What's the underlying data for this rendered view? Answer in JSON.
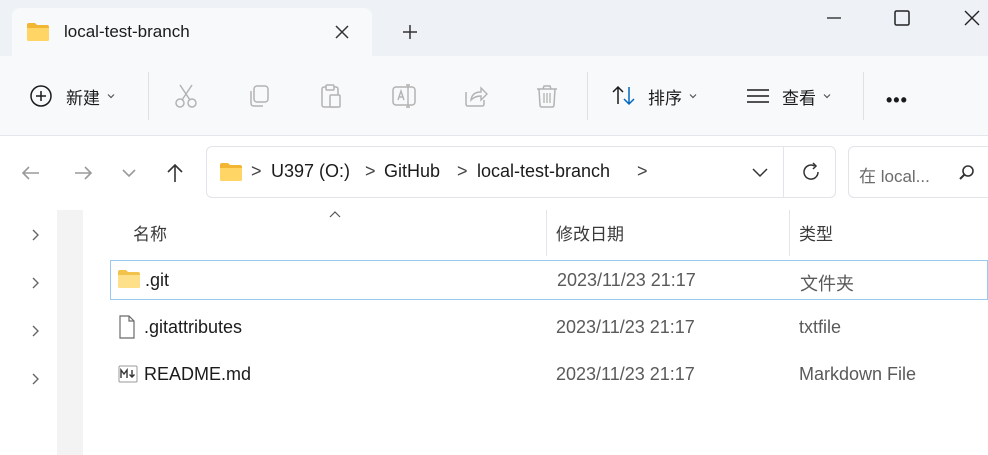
{
  "window": {
    "tab_title": "local-test-branch",
    "icons": [
      "folder-icon",
      "close-icon",
      "plus-icon",
      "minimize-icon",
      "maximize-icon",
      "window-close-icon"
    ]
  },
  "toolbar": {
    "new_label": "新建",
    "sort_label": "排序",
    "view_label": "查看",
    "more_label": "•••"
  },
  "address": {
    "segments": [
      "U397 (O:)",
      "GitHub",
      "local-test-branch"
    ],
    "separator": ">"
  },
  "search": {
    "placeholder": "在 local..."
  },
  "columns": {
    "name": "名称",
    "modified": "修改日期",
    "type": "类型"
  },
  "files": [
    {
      "name": ".git",
      "modified": "2023/11/23 21:17",
      "type": "文件夹",
      "icon": "folder-icon"
    },
    {
      "name": ".gitattributes",
      "modified": "2023/11/23 21:17",
      "type": "txtfile",
      "icon": "file-icon"
    },
    {
      "name": "README.md",
      "modified": "2023/11/23 21:17",
      "type": "Markdown File",
      "icon": "markdown-file-icon"
    }
  ],
  "colors": {
    "accent": "#0067c0",
    "folder": "#f8c94a",
    "selection_border": "#99c9ef"
  }
}
